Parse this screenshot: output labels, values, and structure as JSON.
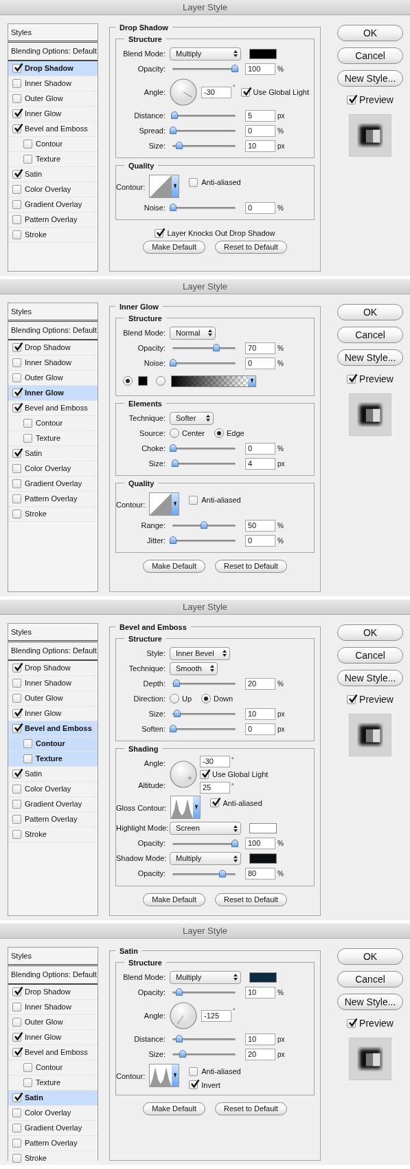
{
  "dialogs": [
    {
      "title": "Layer Style",
      "styles_header": "Styles",
      "blending": "Blending Options: Default",
      "styles": [
        {
          "label": "Drop Shadow",
          "checked": true,
          "selected": true
        },
        {
          "label": "Inner Shadow",
          "checked": false,
          "selected": false
        },
        {
          "label": "Outer Glow",
          "checked": false,
          "selected": false
        },
        {
          "label": "Inner Glow",
          "checked": true,
          "selected": false
        },
        {
          "label": "Bevel and Emboss",
          "checked": true,
          "selected": false,
          "children": [
            {
              "label": "Contour",
              "checked": false,
              "selected": false
            },
            {
              "label": "Texture",
              "checked": false,
              "selected": false
            }
          ]
        },
        {
          "label": "Satin",
          "checked": true,
          "selected": false
        },
        {
          "label": "Color Overlay",
          "checked": false,
          "selected": false
        },
        {
          "label": "Gradient Overlay",
          "checked": false,
          "selected": false
        },
        {
          "label": "Pattern Overlay",
          "checked": false,
          "selected": false
        },
        {
          "label": "Stroke",
          "checked": false,
          "selected": false
        }
      ],
      "section": {
        "title": "Drop Shadow",
        "groups": [
          {
            "title": "Structure",
            "rows": [
              {
                "kind": "select",
                "label": "Blend Mode:",
                "value": "Multiply",
                "color": "#000000"
              },
              {
                "kind": "slider",
                "label": "Opacity:",
                "level": 1,
                "value": "100",
                "unit": "%"
              },
              {
                "kind": "angle",
                "label": "Angle:",
                "value": "-30",
                "unit": "°",
                "check": {
                  "label": "Use Global Light",
                  "checked": true
                }
              },
              {
                "kind": "slider",
                "label": "Distance:",
                "level": 0.02,
                "value": "5",
                "unit": "px"
              },
              {
                "kind": "slider",
                "label": "Spread:",
                "level": 0,
                "value": "0",
                "unit": "%"
              },
              {
                "kind": "slider",
                "label": "Size:",
                "level": 0.1,
                "value": "10",
                "unit": "px"
              }
            ]
          },
          {
            "title": "Quality",
            "rows": [
              {
                "kind": "linearcontour",
                "label": "Contour:",
                "checks": [
                  {
                    "label": "Anti-aliased",
                    "checked": false
                  }
                ]
              },
              {
                "kind": "slider",
                "label": "Noise:",
                "level": 0,
                "value": "0",
                "unit": "%"
              }
            ]
          }
        ],
        "options": [
          {
            "label": "Layer Knocks Out Drop Shadow",
            "checked": true
          }
        ],
        "buttons": [
          "Make Default",
          "Reset to Default"
        ]
      },
      "buttons": [
        "OK",
        "Cancel",
        "New Style..."
      ],
      "preview": {
        "label": "Preview",
        "checked": true
      }
    },
    {
      "title": "Layer Style",
      "styles_header": "Styles",
      "blending": "Blending Options: Default",
      "styles": [
        {
          "label": "Drop Shadow",
          "checked": true,
          "selected": false
        },
        {
          "label": "Inner Shadow",
          "checked": false,
          "selected": false
        },
        {
          "label": "Outer Glow",
          "checked": false,
          "selected": false
        },
        {
          "label": "Inner Glow",
          "checked": true,
          "selected": true
        },
        {
          "label": "Bevel and Emboss",
          "checked": true,
          "selected": false,
          "children": [
            {
              "label": "Contour",
              "checked": false,
              "selected": false
            },
            {
              "label": "Texture",
              "checked": false,
              "selected": false
            }
          ]
        },
        {
          "label": "Satin",
          "checked": true,
          "selected": false
        },
        {
          "label": "Color Overlay",
          "checked": false,
          "selected": false
        },
        {
          "label": "Gradient Overlay",
          "checked": false,
          "selected": false
        },
        {
          "label": "Pattern Overlay",
          "checked": false,
          "selected": false
        },
        {
          "label": "Stroke",
          "checked": false,
          "selected": false
        }
      ],
      "section": {
        "title": "Inner Glow",
        "groups": [
          {
            "title": "Structure",
            "rows": [
              {
                "kind": "select",
                "label": "Blend Mode:",
                "value": "Normal"
              },
              {
                "kind": "slider",
                "label": "Opacity:",
                "level": 0.7,
                "value": "70",
                "unit": "%"
              },
              {
                "kind": "slider",
                "label": "Noise:",
                "level": 0,
                "value": "0",
                "unit": "%"
              },
              {
                "kind": "fill",
                "options": [
                  {
                    "selected": true,
                    "kind": "color",
                    "color": "#000000"
                  },
                  {
                    "selected": false,
                    "kind": "gradient"
                  }
                ]
              }
            ]
          },
          {
            "title": "Elements",
            "rows": [
              {
                "kind": "select",
                "label": "Technique:",
                "value": "Softer"
              },
              {
                "kind": "radio",
                "label": "Source:",
                "options": [
                  {
                    "label": "Center",
                    "selected": false
                  },
                  {
                    "label": "Edge",
                    "selected": true
                  }
                ]
              },
              {
                "kind": "slider",
                "label": "Choke:",
                "level": 0,
                "value": "0",
                "unit": "%"
              },
              {
                "kind": "slider",
                "label": "Size:",
                "level": 0.03,
                "value": "4",
                "unit": "px"
              }
            ]
          },
          {
            "title": "Quality",
            "rows": [
              {
                "kind": "linearcontour",
                "label": "Contour:",
                "checks": [
                  {
                    "label": "Anti-aliased",
                    "checked": false
                  }
                ]
              },
              {
                "kind": "slider",
                "label": "Range:",
                "level": 0.5,
                "value": "50",
                "unit": "%"
              },
              {
                "kind": "slider",
                "label": "Jitter:",
                "level": 0,
                "value": "0",
                "unit": "%"
              }
            ]
          }
        ],
        "buttons": [
          "Make Default",
          "Reset to Default"
        ]
      },
      "buttons": [
        "OK",
        "Cancel",
        "New Style..."
      ],
      "preview": {
        "label": "Preview",
        "checked": true
      }
    },
    {
      "title": "Layer Style",
      "styles_header": "Styles",
      "blending": "Blending Options: Default",
      "styles": [
        {
          "label": "Drop Shadow",
          "checked": true,
          "selected": false
        },
        {
          "label": "Inner Shadow",
          "checked": false,
          "selected": false
        },
        {
          "label": "Outer Glow",
          "checked": false,
          "selected": false
        },
        {
          "label": "Inner Glow",
          "checked": true,
          "selected": false
        },
        {
          "label": "Bevel and Emboss",
          "checked": true,
          "selected": true,
          "children": [
            {
              "label": "Contour",
              "checked": false,
              "selected": true
            },
            {
              "label": "Texture",
              "checked": false,
              "selected": true
            }
          ]
        },
        {
          "label": "Satin",
          "checked": true,
          "selected": false
        },
        {
          "label": "Color Overlay",
          "checked": false,
          "selected": false
        },
        {
          "label": "Gradient Overlay",
          "checked": false,
          "selected": false
        },
        {
          "label": "Pattern Overlay",
          "checked": false,
          "selected": false
        },
        {
          "label": "Stroke",
          "checked": false,
          "selected": false
        }
      ],
      "section": {
        "title": "Bevel and Emboss",
        "groups": [
          {
            "title": "Structure",
            "rows": [
              {
                "kind": "select",
                "label": "Style:",
                "value": "Inner Bevel"
              },
              {
                "kind": "select",
                "label": "Technique:",
                "value": "Smooth"
              },
              {
                "kind": "slider",
                "label": "Depth:",
                "level": 0.05,
                "value": "20",
                "unit": "%"
              },
              {
                "kind": "radio",
                "label": "Direction:",
                "options": [
                  {
                    "label": "Up",
                    "selected": false
                  },
                  {
                    "label": "Down",
                    "selected": true
                  }
                ]
              },
              {
                "kind": "slider",
                "label": "Size:",
                "level": 0.07,
                "value": "10",
                "unit": "px"
              },
              {
                "kind": "slider",
                "label": "Soften:",
                "level": 0,
                "value": "0",
                "unit": "px"
              }
            ]
          },
          {
            "title": "Shading",
            "rows": [
              {
                "kind": "shading",
                "label": "Angle:",
                "value": "-30",
                "unit": "°",
                "check": {
                  "label": "Use Global Light",
                  "checked": true
                },
                "altitude_label": "Altitude:",
                "altitude_value": "25",
                "altitude_unit": "°"
              },
              {
                "kind": "peakscontour",
                "label": "Gloss Contour:",
                "checks": [
                  {
                    "label": "Anti-aliased",
                    "checked": true
                  }
                ]
              },
              {
                "kind": "select",
                "label": "Highlight Mode:",
                "value": "Screen",
                "color": "#ffffff"
              },
              {
                "kind": "slider",
                "label": "Opacity:",
                "level": 1,
                "value": "100",
                "unit": "%"
              },
              {
                "kind": "select",
                "label": "Shadow Mode:",
                "value": "Multiply",
                "color": "#0a0f12"
              },
              {
                "kind": "slider",
                "label": "Opacity:",
                "level": 0.8,
                "value": "80",
                "unit": "%"
              }
            ]
          }
        ],
        "buttons": [
          "Make Default",
          "Reset to Default"
        ]
      },
      "buttons": [
        "OK",
        "Cancel",
        "New Style..."
      ],
      "preview": {
        "label": "Preview",
        "checked": true
      }
    },
    {
      "title": "Layer Style",
      "styles_header": "Styles",
      "blending": "Blending Options: Default",
      "styles": [
        {
          "label": "Drop Shadow",
          "checked": true,
          "selected": false
        },
        {
          "label": "Inner Shadow",
          "checked": false,
          "selected": false
        },
        {
          "label": "Outer Glow",
          "checked": false,
          "selected": false
        },
        {
          "label": "Inner Glow",
          "checked": true,
          "selected": false
        },
        {
          "label": "Bevel and Emboss",
          "checked": true,
          "selected": false,
          "children": [
            {
              "label": "Contour",
              "checked": false,
              "selected": false
            },
            {
              "label": "Texture",
              "checked": false,
              "selected": false
            }
          ]
        },
        {
          "label": "Satin",
          "checked": true,
          "selected": true
        },
        {
          "label": "Color Overlay",
          "checked": false,
          "selected": false
        },
        {
          "label": "Gradient Overlay",
          "checked": false,
          "selected": false
        },
        {
          "label": "Pattern Overlay",
          "checked": false,
          "selected": false
        },
        {
          "label": "Stroke",
          "checked": false,
          "selected": false
        }
      ],
      "section": {
        "title": "Satin",
        "groups": [
          {
            "title": "Structure",
            "rows": [
              {
                "kind": "select",
                "label": "Blend Mode:",
                "value": "Multiply",
                "color": "#0d2a40"
              },
              {
                "kind": "slider",
                "label": "Opacity:",
                "level": 0.1,
                "value": "10",
                "unit": "%"
              },
              {
                "kind": "angle",
                "label": "Angle:",
                "value": "-125",
                "unit": "°"
              },
              {
                "kind": "slider",
                "label": "Distance:",
                "level": 0.1,
                "value": "10",
                "unit": "px"
              },
              {
                "kind": "slider",
                "label": "Size:",
                "level": 0.15,
                "value": "20",
                "unit": "px"
              },
              {
                "kind": "peakscontour",
                "label": "Contour:",
                "checks": [
                  {
                    "label": "Anti-aliased",
                    "checked": false
                  },
                  {
                    "label": "Invert",
                    "checked": true
                  }
                ]
              }
            ]
          }
        ],
        "buttons": [
          "Make Default",
          "Reset to Default"
        ]
      },
      "buttons": [
        "OK",
        "Cancel",
        "New Style..."
      ],
      "preview": {
        "label": "Preview",
        "checked": true
      }
    }
  ]
}
